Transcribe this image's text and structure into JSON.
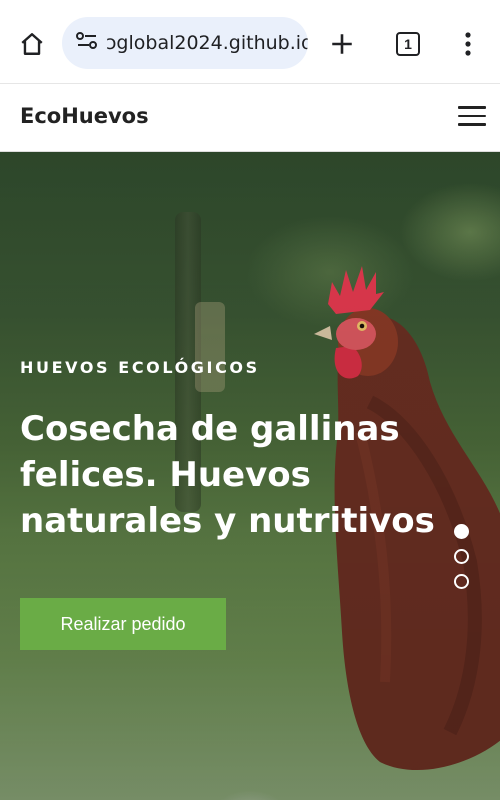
{
  "browser": {
    "url": "ɔglobal2024.github.io",
    "tab_count": "1",
    "icons": [
      "home-icon",
      "site-settings-icon",
      "new-tab-icon",
      "tab-switcher-icon",
      "more-menu-icon"
    ]
  },
  "site": {
    "brand": "EcoHuevos",
    "menu_icon": "hamburger-icon"
  },
  "hero": {
    "eyebrow": "HUEVOS ECOLÓGICOS",
    "headline": "Cosecha de gallinas felices. Huevos naturales y nutritivos",
    "cta_label": "Realizar pedido",
    "slides": 3,
    "active_slide": 1
  },
  "colors": {
    "cta": "#6aac46",
    "hen_comb": "#e53a4f",
    "hen_body": "#6a2f22"
  }
}
